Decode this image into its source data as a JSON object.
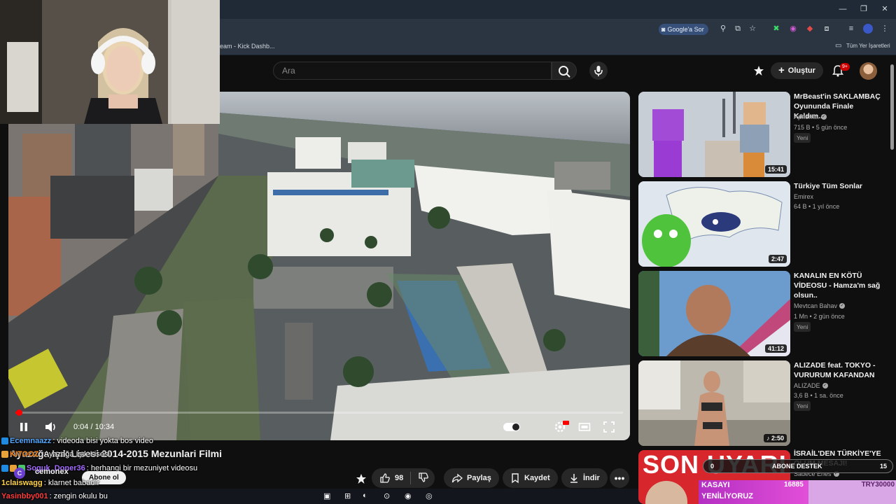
{
  "browser": {
    "window_controls": {
      "minimize": "—",
      "maximize": "❐",
      "close": "✕"
    },
    "google_sor_label": "Google'a Sor",
    "bookmark_tab": "eam - Kick Dashb...",
    "bookmarks_label": "Tüm Yer İşaretleri"
  },
  "header": {
    "search_placeholder": "Ara",
    "create_label": "Oluştur",
    "notification_count": "9+"
  },
  "player": {
    "time": "0:04 / 10:34",
    "progress": 0.0063
  },
  "video": {
    "title": "Ayazağa Işık Lisesi 2014-2015 Mezunlari Filmi"
  },
  "actions": {
    "like_count": "98",
    "share_label": "Paylaş",
    "save_label": "Kaydet",
    "download_label": "İndir"
  },
  "chat": {
    "lines": [
      {
        "user": "Ecemnaazz",
        "text": ": videoda bisi yokta bos video",
        "color": "#54a7ff"
      },
      {
        "user": "KITOOZ",
        "text": ": Ayazağa Işık Lisesi",
        "color": "#ff8a1e"
      },
      {
        "user": "Soguk_Doner36",
        "text": ": herhangi bir mezuniyet videosu",
        "color": "#a56bff"
      },
      {
        "user": "1claiswagg",
        "text": ": klarnet babadır",
        "color": "#ffd44a"
      },
      {
        "user": "Yasinbby001",
        "text": ": zengin okulu bu",
        "color": "#ff3b3b"
      }
    ],
    "channel_name": "cemonex",
    "subscribe_label": "Abone ol"
  },
  "recommendations": [
    {
      "title": "MrBeast'in SAKLAMBAÇ Oyununda Finale Kaldım...",
      "channel": "Aphernix",
      "verified": true,
      "views": "715 B",
      "age": "5 gün önce",
      "new": "Yeni",
      "duration": "15:41"
    },
    {
      "title": "Türkiye Tüm Sonlar",
      "channel": "Emirex",
      "verified": false,
      "views": "64 B",
      "age": "1 yıl önce",
      "new": "",
      "duration": "2:47"
    },
    {
      "title": "KANALIN EN KÖTÜ VİDEOSU - Hamza'm sağ olsun..",
      "channel": "Mevtcan Bahav",
      "verified": true,
      "views": "1 Mn",
      "age": "2 gün önce",
      "new": "Yeni",
      "duration": "41:12"
    },
    {
      "title": "ALIZADE feat. TOKYO - VURURUM KAFANDAN",
      "channel": "ALIZADE",
      "verified": true,
      "views": "3,6 B",
      "age": "1 sa. önce",
      "new": "Yeni",
      "duration": "2:50"
    },
    {
      "title": "İSRAİL'DEN TÜRKİYE'YE ÖLÜM MESAJI!",
      "channel": "Sadece Enes",
      "verified": true,
      "views": "",
      "age": "",
      "new": "",
      "duration": ""
    }
  ],
  "partial_thumbnail_text": "SON UYARI",
  "stream": {
    "sub_goal_start": "0",
    "sub_goal_label": "ABONE DESTEK",
    "sub_goal_target": "15",
    "kasa_line1": "KASAYI",
    "kasa_line2": "YENİLİYORUZ",
    "kasa_current": "16885",
    "kasa_target": "TRY30000"
  },
  "colors": {
    "background": "#0f0f0f",
    "accent_red": "#ff0000",
    "pill_bg": "#272727"
  }
}
